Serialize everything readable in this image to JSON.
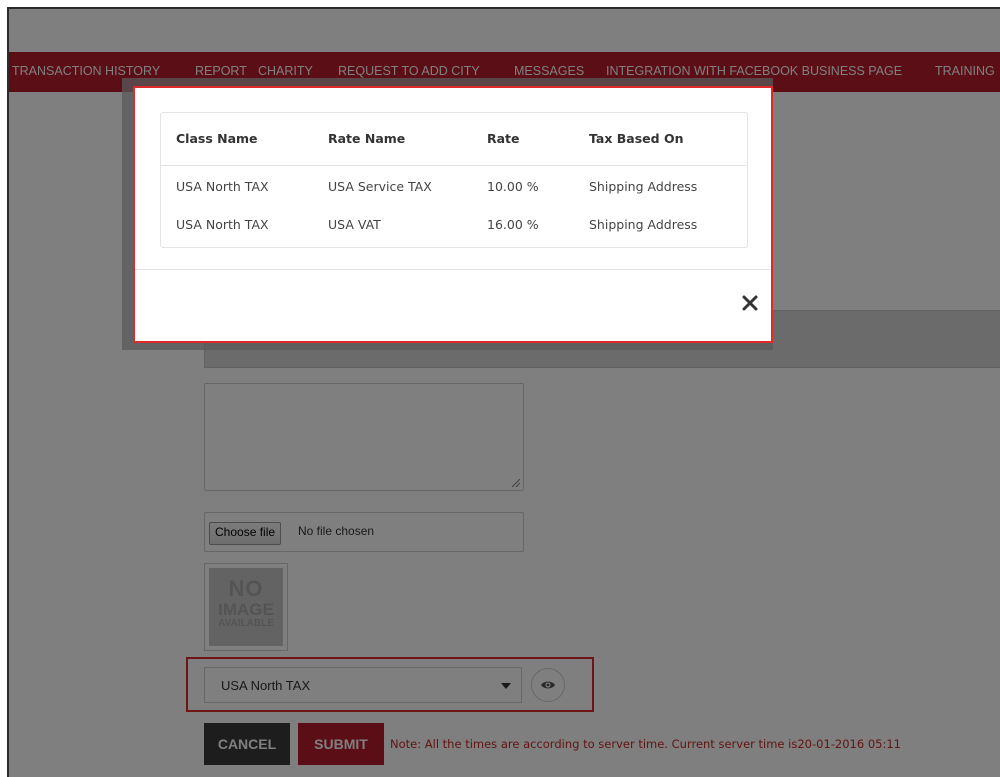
{
  "nav": {
    "items": [
      {
        "label": "Transaction History"
      },
      {
        "label": "Report"
      },
      {
        "label": "Charity"
      },
      {
        "label": "Request to add city"
      },
      {
        "label": "Messages"
      },
      {
        "label": "Integration with Facebook Business Page"
      },
      {
        "label": "Training"
      }
    ]
  },
  "form": {
    "file": {
      "button_label": "Choose file",
      "status": "No file chosen"
    },
    "no_image": {
      "line1": "NO",
      "line2": "IMAGE",
      "line3": "AVAILABLE"
    },
    "tax_class": {
      "selected": "USA North TAX"
    },
    "view_icon": "eye-icon",
    "cancel_label": "CANCEL",
    "submit_label": "SUBMIT",
    "note": "Note: All the times are according to server time. Current server time is20-01-2016 05:11"
  },
  "modal": {
    "columns": [
      "Class Name",
      "Rate Name",
      "Rate",
      "Tax Based On"
    ],
    "rows": [
      {
        "class_name": "USA North TAX",
        "rate_name": "USA Service TAX",
        "rate": "10.00 %",
        "tax_based_on": "Shipping Address"
      },
      {
        "class_name": "USA North TAX",
        "rate_name": "USA VAT",
        "rate": "16.00 %",
        "tax_based_on": "Shipping Address"
      }
    ],
    "close_icon": "close-icon"
  },
  "colors": {
    "brand_red": "#b71c2b",
    "highlight_red": "#e02a2a",
    "note_red": "#c62828",
    "cancel_dark": "#3b3b3b"
  }
}
